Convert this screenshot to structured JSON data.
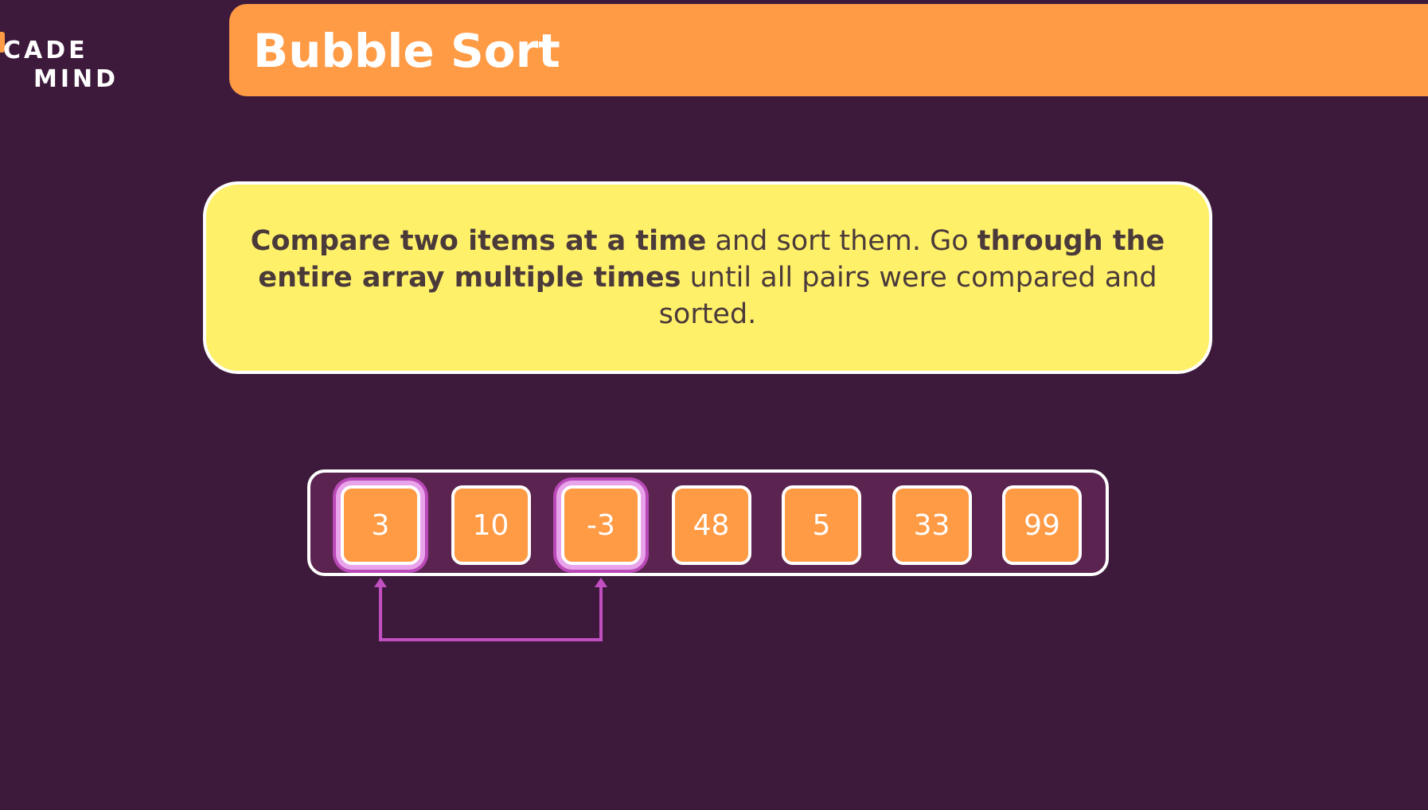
{
  "logo": {
    "line1": "CADE",
    "line2": "MIND"
  },
  "header": {
    "title": "Bubble Sort"
  },
  "card": {
    "segments": [
      {
        "text": "Compare two items at a time",
        "bold": true
      },
      {
        "text": " and sort them. Go ",
        "bold": false
      },
      {
        "text": "through the entire array multiple times",
        "bold": true
      },
      {
        "text": " until all pairs were compared and sorted.",
        "bold": false
      }
    ]
  },
  "array": {
    "values": [
      "3",
      "10",
      "-3",
      "48",
      "5",
      "33",
      "99"
    ],
    "highlighted_indices": [
      0,
      2
    ]
  },
  "colors": {
    "background": "#3d1a3b",
    "accent_orange": "#ff9a45",
    "card_yellow": "#fff06a",
    "highlight_purple": "#b949b6",
    "connector_purple": "#c24fc1"
  }
}
